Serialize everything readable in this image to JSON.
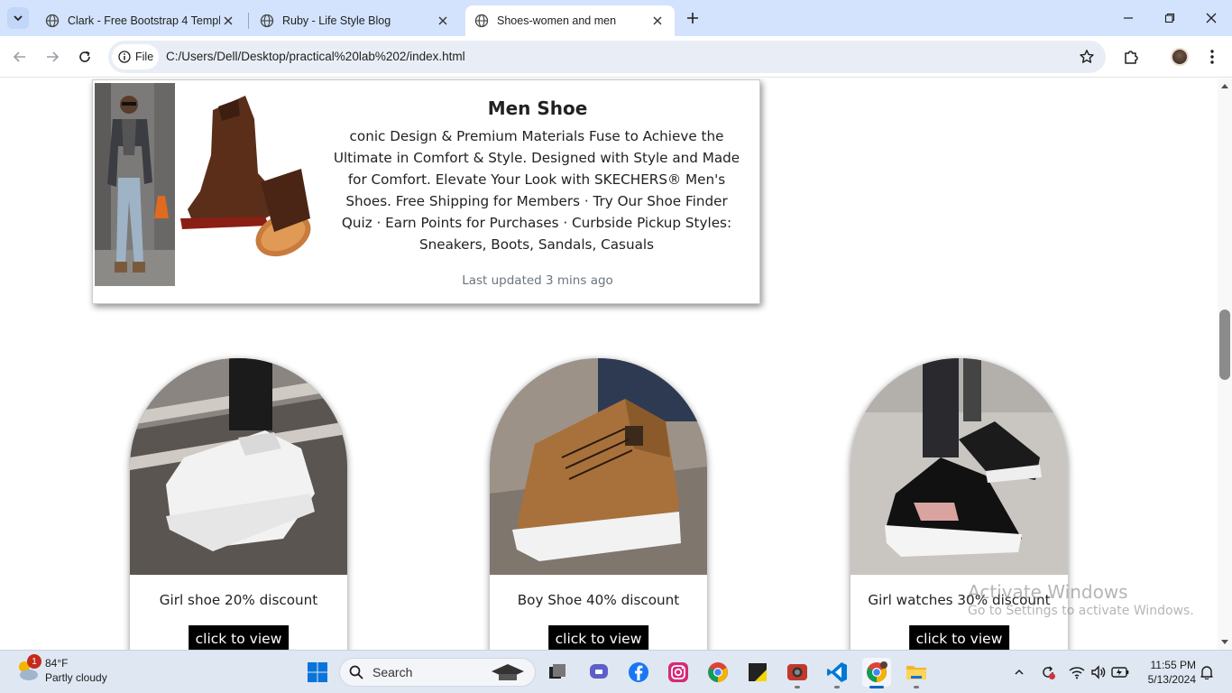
{
  "browser": {
    "tabs": [
      {
        "title": "Clark - Free Bootstrap 4 Templa",
        "active": false
      },
      {
        "title": "Ruby - Life Style Blog",
        "active": false
      },
      {
        "title": "Shoes-women and men",
        "active": true
      }
    ],
    "address": {
      "chip_label": "File",
      "url": "C:/Users/Dell/Desktop/practical%20lab%202/index.html"
    }
  },
  "page": {
    "men_card": {
      "title": "Men Shoe",
      "description": "conic Design & Premium Materials Fuse to Achieve the Ultimate in Comfort & Style. Designed with Style and Made for Comfort. Elevate Your Look with SKECHERS® Men's Shoes. Free Shipping for Members · Try Our Shoe Finder Quiz · Earn Points for Purchases · Curbside Pickup Styles: Sneakers, Boots, Sandals, Casuals",
      "updated": "Last updated 3 mins ago"
    },
    "products": [
      {
        "caption": "Girl shoe 20% discount",
        "button": "click to view"
      },
      {
        "caption": "Boy Shoe 40% discount",
        "button": "click to view"
      },
      {
        "caption": "Girl watches 30% discount",
        "button": "click to view"
      }
    ],
    "watermark": {
      "title": "Activate Windows",
      "subtitle": "Go to Settings to activate Windows."
    }
  },
  "taskbar": {
    "weather": {
      "temp": "84°F",
      "condition": "Partly cloudy",
      "badge": "1"
    },
    "search_placeholder": "Search",
    "clock": {
      "time": "11:55 PM",
      "date": "5/13/2024"
    }
  },
  "colors": {
    "tabstrip": "#d3e3fd",
    "omnibox": "#e9eef6",
    "button_bg": "#000000",
    "taskbar": "#dfe7f2",
    "accent": "#0067c0"
  }
}
